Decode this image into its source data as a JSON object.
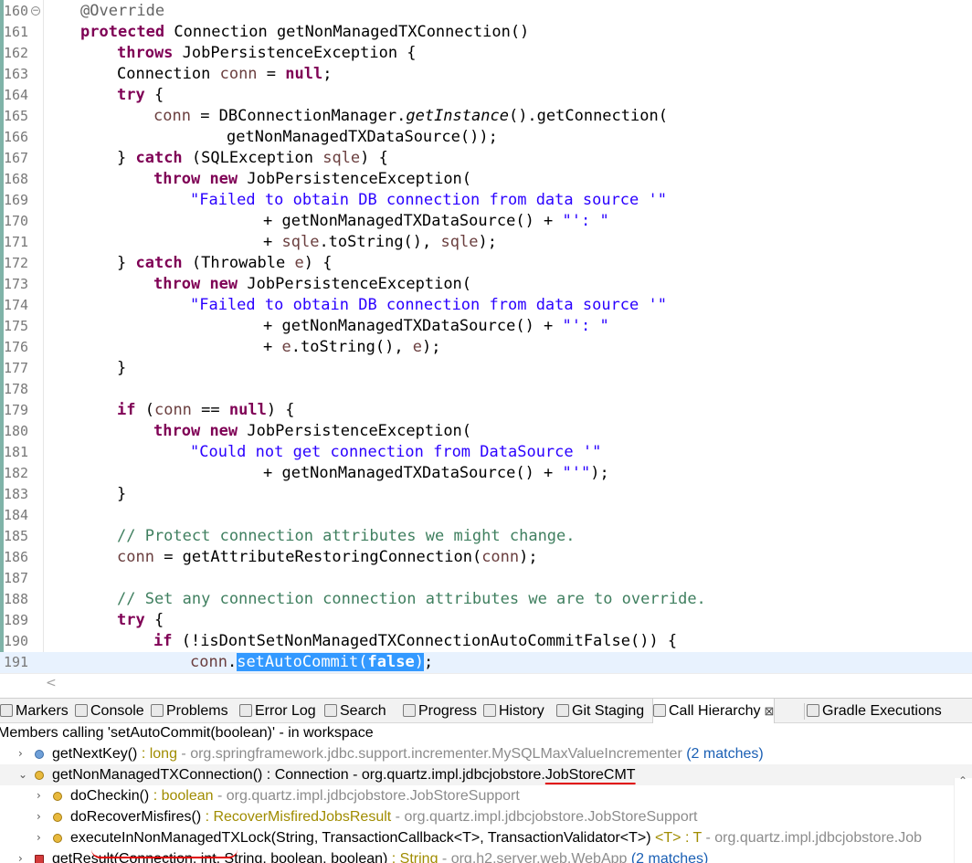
{
  "editor": {
    "lines": [
      {
        "n": "160",
        "fold": true,
        "indent": 1,
        "segs": [
          {
            "t": "@Override",
            "c": "ann"
          }
        ]
      },
      {
        "n": "161",
        "indent": 1,
        "segs": [
          {
            "t": "protected",
            "c": "kw"
          },
          {
            "t": " Connection getNonManagedTXConnection()"
          }
        ]
      },
      {
        "n": "162",
        "indent": 2,
        "segs": [
          {
            "t": "throws",
            "c": "kw"
          },
          {
            "t": " JobPersistenceException {"
          }
        ]
      },
      {
        "n": "163",
        "indent": 2,
        "segs": [
          {
            "t": "Connection "
          },
          {
            "t": "conn",
            "c": "var"
          },
          {
            "t": " = "
          },
          {
            "t": "null",
            "c": "kw"
          },
          {
            "t": ";"
          }
        ]
      },
      {
        "n": "164",
        "indent": 2,
        "segs": [
          {
            "t": "try",
            "c": "kw"
          },
          {
            "t": " {"
          }
        ]
      },
      {
        "n": "165",
        "indent": 3,
        "segs": [
          {
            "t": "conn",
            "c": "var"
          },
          {
            "t": " = DBConnectionManager."
          },
          {
            "t": "getInstance",
            "c": "it"
          },
          {
            "t": "().getConnection("
          }
        ]
      },
      {
        "n": "166",
        "indent": 5,
        "segs": [
          {
            "t": "getNonManagedTXDataSource());"
          }
        ]
      },
      {
        "n": "167",
        "indent": 2,
        "segs": [
          {
            "t": "} "
          },
          {
            "t": "catch",
            "c": "kw"
          },
          {
            "t": " (SQLException "
          },
          {
            "t": "sqle",
            "c": "var"
          },
          {
            "t": ") {"
          }
        ]
      },
      {
        "n": "168",
        "indent": 3,
        "segs": [
          {
            "t": "throw",
            "c": "kw"
          },
          {
            "t": " "
          },
          {
            "t": "new",
            "c": "kw"
          },
          {
            "t": " JobPersistenceException("
          }
        ]
      },
      {
        "n": "169",
        "indent": 4,
        "segs": [
          {
            "t": "\"Failed to obtain DB connection from data source '\"",
            "c": "str"
          }
        ]
      },
      {
        "n": "170",
        "indent": 6,
        "segs": [
          {
            "t": "+ getNonManagedTXDataSource() + "
          },
          {
            "t": "\"': \"",
            "c": "str"
          }
        ]
      },
      {
        "n": "171",
        "indent": 6,
        "segs": [
          {
            "t": "+ "
          },
          {
            "t": "sqle",
            "c": "var"
          },
          {
            "t": ".toString(), "
          },
          {
            "t": "sqle",
            "c": "var"
          },
          {
            "t": ");"
          }
        ]
      },
      {
        "n": "172",
        "indent": 2,
        "segs": [
          {
            "t": "} "
          },
          {
            "t": "catch",
            "c": "kw"
          },
          {
            "t": " (Throwable "
          },
          {
            "t": "e",
            "c": "var"
          },
          {
            "t": ") {"
          }
        ]
      },
      {
        "n": "173",
        "indent": 3,
        "segs": [
          {
            "t": "throw",
            "c": "kw"
          },
          {
            "t": " "
          },
          {
            "t": "new",
            "c": "kw"
          },
          {
            "t": " JobPersistenceException("
          }
        ]
      },
      {
        "n": "174",
        "indent": 4,
        "segs": [
          {
            "t": "\"Failed to obtain DB connection from data source '\"",
            "c": "str"
          }
        ]
      },
      {
        "n": "175",
        "indent": 6,
        "segs": [
          {
            "t": "+ getNonManagedTXDataSource() + "
          },
          {
            "t": "\"': \"",
            "c": "str"
          }
        ]
      },
      {
        "n": "176",
        "indent": 6,
        "segs": [
          {
            "t": "+ "
          },
          {
            "t": "e",
            "c": "var"
          },
          {
            "t": ".toString(), "
          },
          {
            "t": "e",
            "c": "var"
          },
          {
            "t": ");"
          }
        ]
      },
      {
        "n": "177",
        "indent": 2,
        "segs": [
          {
            "t": "}"
          }
        ]
      },
      {
        "n": "178",
        "indent": 0,
        "segs": []
      },
      {
        "n": "179",
        "indent": 2,
        "segs": [
          {
            "t": "if",
            "c": "kw"
          },
          {
            "t": " ("
          },
          {
            "t": "conn",
            "c": "var"
          },
          {
            "t": " == "
          },
          {
            "t": "null",
            "c": "kw"
          },
          {
            "t": ") {"
          }
        ]
      },
      {
        "n": "180",
        "indent": 3,
        "segs": [
          {
            "t": "throw",
            "c": "kw"
          },
          {
            "t": " "
          },
          {
            "t": "new",
            "c": "kw"
          },
          {
            "t": " JobPersistenceException("
          }
        ]
      },
      {
        "n": "181",
        "indent": 4,
        "segs": [
          {
            "t": "\"Could not get connection from DataSource '\"",
            "c": "str"
          }
        ]
      },
      {
        "n": "182",
        "indent": 6,
        "segs": [
          {
            "t": "+ getNonManagedTXDataSource() + "
          },
          {
            "t": "\"'\"",
            "c": "str"
          },
          {
            "t": ");"
          }
        ]
      },
      {
        "n": "183",
        "indent": 2,
        "segs": [
          {
            "t": "}"
          }
        ]
      },
      {
        "n": "184",
        "indent": 0,
        "segs": []
      },
      {
        "n": "185",
        "indent": 2,
        "segs": [
          {
            "t": "// Protect connection attributes we might change.",
            "c": "cmt"
          }
        ]
      },
      {
        "n": "186",
        "indent": 2,
        "segs": [
          {
            "t": "conn",
            "c": "var"
          },
          {
            "t": " = getAttributeRestoringConnection("
          },
          {
            "t": "conn",
            "c": "var"
          },
          {
            "t": ");"
          }
        ]
      },
      {
        "n": "187",
        "indent": 0,
        "segs": []
      },
      {
        "n": "188",
        "indent": 2,
        "segs": [
          {
            "t": "// Set any connection connection attributes we are to override.",
            "c": "cmt"
          }
        ]
      },
      {
        "n": "189",
        "indent": 2,
        "segs": [
          {
            "t": "try",
            "c": "kw"
          },
          {
            "t": " {"
          }
        ]
      },
      {
        "n": "190",
        "indent": 3,
        "segs": [
          {
            "t": "if",
            "c": "kw"
          },
          {
            "t": " (!isDontSetNonManagedTXConnectionAutoCommitFalse()) {"
          }
        ]
      },
      {
        "n": "191",
        "indent": 4,
        "current": true,
        "segs": [
          {
            "t": "conn",
            "c": "var"
          },
          {
            "t": "."
          },
          {
            "t": "setAutoCommit(",
            "c": "sel"
          },
          {
            "t": "false",
            "c": "sel kw"
          },
          {
            "t": ")",
            "c": "sel"
          },
          {
            "t": ";"
          }
        ]
      }
    ]
  },
  "tabs": [
    {
      "label": "Markers",
      "icon": "markers-icon"
    },
    {
      "label": "Console",
      "icon": "console-icon"
    },
    {
      "label": "Problems",
      "icon": "problems-icon"
    },
    {
      "label": "Error Log",
      "icon": "error-log-icon"
    },
    {
      "label": "Search",
      "icon": "search-icon"
    },
    {
      "label": "Progress",
      "icon": "progress-icon"
    },
    {
      "label": "History",
      "icon": "history-icon"
    },
    {
      "label": "Git Staging",
      "icon": "git-staging-icon"
    },
    {
      "label": "Call Hierarchy",
      "icon": "call-hierarchy-icon",
      "active": true,
      "close": "⊠"
    },
    {
      "label": "Gradle Executions",
      "icon": "gradle-icon"
    }
  ],
  "call_hierarchy": {
    "description": "Members calling 'setAutoCommit(boolean)' - in workspace",
    "rows": [
      {
        "level": 1,
        "twisty": "›",
        "icon": "deflt",
        "segs": [
          {
            "t": "getNextKey()"
          },
          {
            "t": " : long",
            "c": "olive"
          },
          {
            "t": " - org.springframework.jdbc.support.incrementer.MySQLMaxValueIncrementer",
            "c": "gray"
          },
          {
            "t": " (2 matches)",
            "c": "blue"
          }
        ]
      },
      {
        "level": 1,
        "twisty": "⌄",
        "icon": "prot",
        "selected": true,
        "segs": [
          {
            "t": "getNonManagedTXConnection() : Connection - org.quartz.impl.jdbcjobstore."
          },
          {
            "t": "JobStoreCMT",
            "c": "uline"
          }
        ]
      },
      {
        "level": 2,
        "twisty": "›",
        "icon": "prot",
        "segs": [
          {
            "t": "doCheckin()"
          },
          {
            "t": " : boolean",
            "c": "olive"
          },
          {
            "t": " - org.quartz.impl.jdbcjobstore.JobStoreSupport",
            "c": "gray"
          }
        ]
      },
      {
        "level": 2,
        "twisty": "›",
        "icon": "prot",
        "segs": [
          {
            "t": "doRecoverMisfires()"
          },
          {
            "t": " : RecoverMisfiredJobsResult",
            "c": "olive"
          },
          {
            "t": " - org.quartz.impl.jdbcjobstore.JobStoreSupport",
            "c": "gray"
          }
        ]
      },
      {
        "level": 2,
        "twisty": "›",
        "icon": "prot",
        "segs": [
          {
            "t": "executeInNonManagedTXLock(String, TransactionCallback<T>, TransactionValidator<T>)"
          },
          {
            "t": " <T> : T",
            "c": "olive"
          },
          {
            "t": " - org.quartz.impl.jdbcjobstore.Job",
            "c": "gray"
          }
        ]
      },
      {
        "level": 1,
        "twisty": "›",
        "icon": "priv",
        "segs": [
          {
            "t": "getResult(Connection, int, String, boolean, boolean)"
          },
          {
            "t": " : String",
            "c": "olive"
          },
          {
            "t": " - org.h2.server.web.WebApp",
            "c": "gray"
          },
          {
            "t": " (2 matches)",
            "c": "blue"
          }
        ]
      }
    ]
  }
}
